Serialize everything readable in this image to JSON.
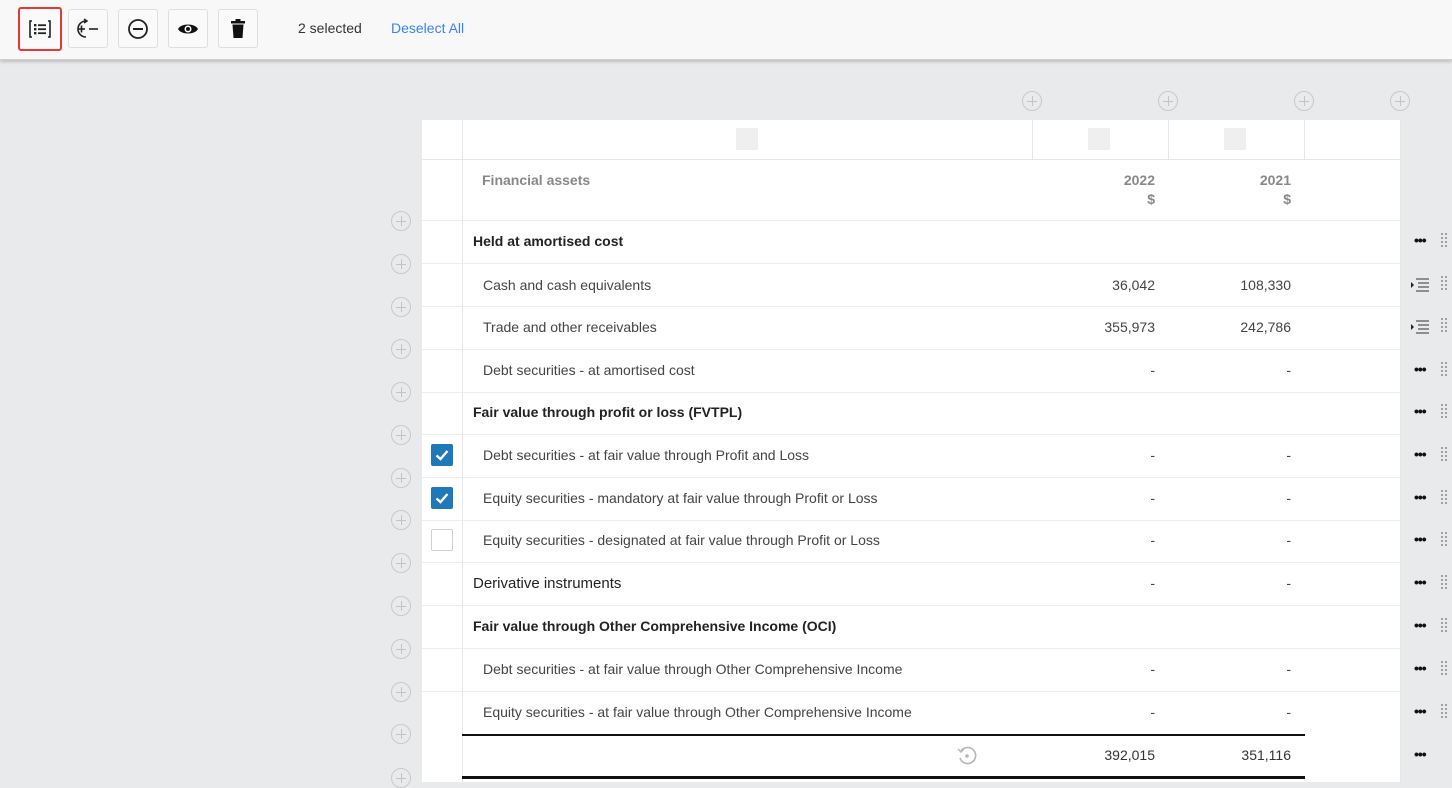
{
  "toolbar": {
    "buttons": [
      {
        "icon": "list-select-icon",
        "active": true
      },
      {
        "icon": "add-remove-row-icon",
        "active": false
      },
      {
        "icon": "minus-circle-icon",
        "active": false
      },
      {
        "icon": "eye-icon",
        "active": false
      },
      {
        "icon": "trash-icon",
        "active": false
      }
    ],
    "selected_text": "2 selected",
    "deselect_label": "Deselect All"
  },
  "table": {
    "header_label": "Financial assets",
    "col_2022_year": "2022",
    "col_2022_unit": "$",
    "col_2021_year": "2021",
    "col_2021_unit": "$",
    "rows": [
      {
        "label": "Held at amortised cost",
        "style": "bold",
        "v2022": "",
        "v2021": ""
      },
      {
        "label": "Cash and cash equivalents",
        "style": "normal",
        "v2022": "36,042",
        "v2021": "108,330"
      },
      {
        "label": "Trade and other receivables",
        "style": "normal",
        "v2022": "355,973",
        "v2021": "242,786"
      },
      {
        "label": "Debt securities - at amortised cost",
        "style": "normal",
        "v2022": "-",
        "v2021": "-"
      },
      {
        "label": "Fair value through profit or loss (FVTPL)",
        "style": "bold",
        "v2022": "",
        "v2021": ""
      },
      {
        "label": "Debt securities - at fair value through Profit and Loss",
        "style": "normal",
        "v2022": "-",
        "v2021": "-",
        "checked": true
      },
      {
        "label": "Equity securities - mandatory at fair value through Profit or Loss",
        "style": "normal",
        "v2022": "-",
        "v2021": "-",
        "checked": true
      },
      {
        "label": "Equity securities - designated at fair value through Profit or Loss",
        "style": "normal",
        "v2022": "-",
        "v2021": "-",
        "checked": false
      },
      {
        "label": "Derivative instruments",
        "style": "plain",
        "v2022": "-",
        "v2021": "-"
      },
      {
        "label": "Fair value through Other Comprehensive Income (OCI)",
        "style": "bold",
        "v2022": "",
        "v2021": ""
      },
      {
        "label": "Debt securities - at fair value through Other Comprehensive Income",
        "style": "normal",
        "v2022": "-",
        "v2021": "-"
      },
      {
        "label": "Equity securities - at fair value through Other Comprehensive Income",
        "style": "normal",
        "v2022": "-",
        "v2021": "-"
      }
    ],
    "total_2022": "392,015",
    "total_2021": "351,116"
  },
  "colors": {
    "accent_link": "#3b82f6",
    "checkbox_on": "#1f79b8",
    "active_outline": "#e53935"
  }
}
